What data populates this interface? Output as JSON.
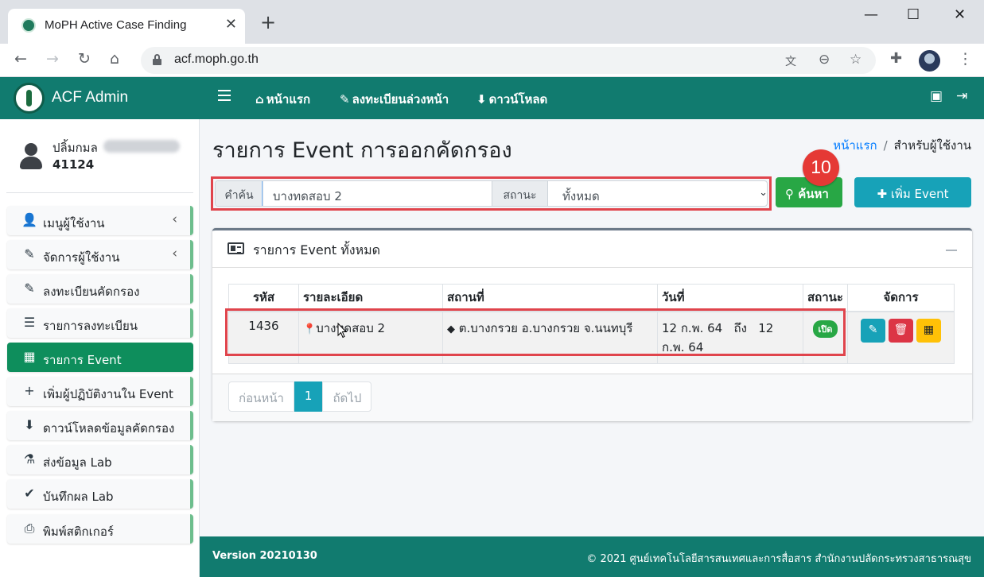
{
  "browser": {
    "tab_title": "MoPH Active Case Finding",
    "tab_close": "✕",
    "new_tab": "+",
    "url": "acf.moph.go.th",
    "window_controls": [
      "—",
      "☐",
      "✕"
    ]
  },
  "app": {
    "brand": "ACF Admin",
    "user": {
      "name": "ปลิ้มกมล",
      "code": "41124"
    },
    "sidebar": {
      "items": [
        {
          "label": "เมนูผู้ใช้งาน",
          "icon": "user-icon",
          "glyph": "👤",
          "has_caret": true,
          "active": false
        },
        {
          "label": "จัดการผู้ใช้งาน",
          "icon": "user-edit-icon",
          "glyph": "✎",
          "has_caret": true,
          "active": false
        },
        {
          "label": "ลงทะเบียนคัดกรอง",
          "icon": "user-edit-icon",
          "glyph": "✎",
          "has_caret": false,
          "active": false
        },
        {
          "label": "รายการลงทะเบียน",
          "icon": "list-icon",
          "glyph": "☰",
          "has_caret": false,
          "active": false
        },
        {
          "label": "รายการ Event",
          "icon": "calendar-check-icon",
          "glyph": "▦",
          "has_caret": false,
          "active": true
        },
        {
          "label": "เพิ่มผู้ปฏิบัติงานใน Event",
          "icon": "user-plus-icon",
          "glyph": "+",
          "has_caret": false,
          "active": false
        },
        {
          "label": "ดาวน์โหลดข้อมูลคัดกรอง",
          "icon": "download-icon",
          "glyph": "⬇",
          "has_caret": false,
          "active": false
        },
        {
          "label": "ส่งข้อมูล Lab",
          "icon": "vials-icon",
          "glyph": "⚗",
          "has_caret": false,
          "active": false
        },
        {
          "label": "บันทึกผล Lab",
          "icon": "clipboard-check-icon",
          "glyph": "✔",
          "has_caret": false,
          "active": false
        },
        {
          "label": "พิมพ์สติกเกอร์",
          "icon": "print-icon",
          "glyph": "⎙",
          "has_caret": false,
          "active": false
        }
      ],
      "caret": "‹"
    },
    "topnav": {
      "home": "หน้าแรก",
      "preregister": "ลงทะเบียนล่วงหน้า",
      "download": "ดาวน์โหลด"
    }
  },
  "page": {
    "title": "รายการ Event การออกคัดกรอง",
    "breadcrumb": {
      "home": "หน้าแรก",
      "separator": "/",
      "current": "สำหรับผู้ใช้งาน"
    },
    "search": {
      "keyword_label": "คำค้น",
      "keyword_value": "บางทดสอบ 2",
      "status_label": "สถานะ",
      "status_value": "ทั้งหมด",
      "search_button": "ค้นหา",
      "add_button": "เพิ่ม Event"
    },
    "step_number": "10",
    "card_title": "รายการ Event ทั้งหมด",
    "table": {
      "headers": [
        "รหัส",
        "รายละเอียด",
        "สถานที่",
        "วันที่",
        "สถานะ",
        "จัดการ"
      ],
      "rows": [
        {
          "id": "1436",
          "detail": "บางทดสอบ 2",
          "place": "ต.บางกรวย อ.บางกรวย จ.นนทบุรี",
          "date": "12 ก.พ. 64   ถึง   12 ก.พ. 64",
          "status": "เปิด"
        }
      ]
    },
    "pagination": {
      "prev": "ก่อนหน้า",
      "current": "1",
      "next": "ถัดไป"
    }
  },
  "footer": {
    "version": "Version 20210130",
    "copyright": "© 2021 ศูนย์เทคโนโลยีสารสนเทศและการสื่อสาร สำนักงานปลัดกระทรวงสาธารณสุข"
  },
  "colors": {
    "primary": "#117b6f",
    "active_menu": "#0e8e5c",
    "search_button": "#28a745",
    "add_button": "#17a2b8",
    "highlight": "#e0444c"
  }
}
